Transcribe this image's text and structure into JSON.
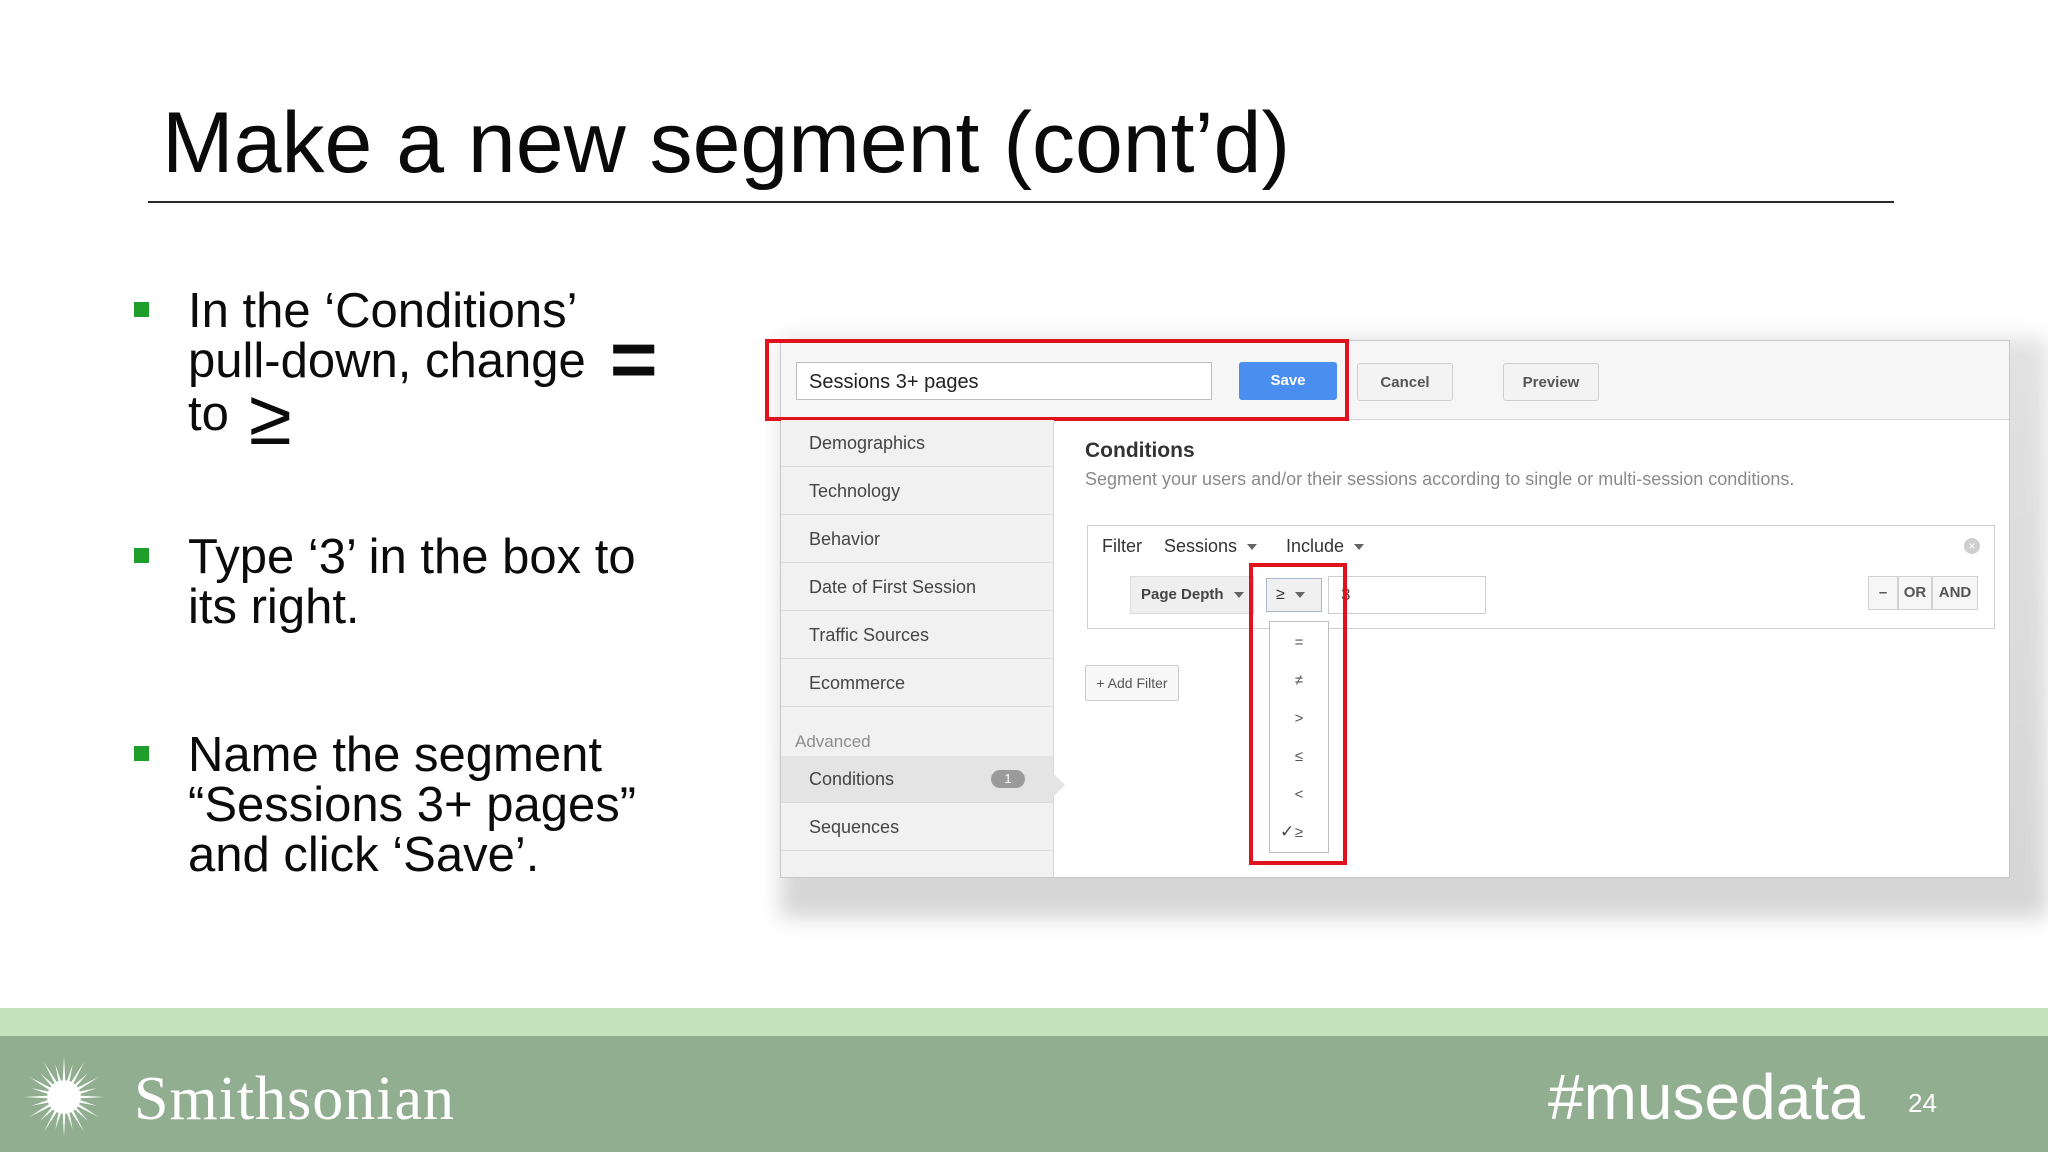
{
  "slide": {
    "title": "Make a new segment (cont’d)",
    "bullets": [
      {
        "lines": [
          "In the ‘Conditions’",
          "pull-down, change",
          "to"
        ],
        "symbol_equals": "=",
        "symbol_gte": "≥"
      },
      {
        "lines": [
          "Type ‘3’ in the box to",
          "its right."
        ]
      },
      {
        "lines": [
          "Name the segment",
          "“Sessions 3+ pages”",
          "and click ‘Save’."
        ]
      }
    ],
    "accent_color": "#1e9e2a",
    "highlight_color": "#e0121d"
  },
  "screenshot": {
    "segment_name": "Sessions 3+ pages",
    "buttons": {
      "save": "Save",
      "cancel": "Cancel",
      "preview": "Preview"
    },
    "nav": {
      "items": [
        "Demographics",
        "Technology",
        "Behavior",
        "Date of First Session",
        "Traffic Sources",
        "Ecommerce"
      ],
      "advanced_caption": "Advanced",
      "conditions": "Conditions",
      "conditions_badge": "1",
      "sequences": "Sequences"
    },
    "conditions": {
      "title": "Conditions",
      "description": "Segment your users and/or their sessions according to single or multi-session conditions."
    },
    "filter": {
      "label": "Filter",
      "scope": "Sessions",
      "mode": "Include",
      "dimension": "Page Depth",
      "operator": "≥",
      "value": "3",
      "logic_minus": "–",
      "logic_or": "OR",
      "logic_and": "AND",
      "add_filter": "+ Add Filter"
    },
    "operator_options": [
      "=",
      "≠",
      ">",
      "≤",
      "<",
      "≥"
    ],
    "operator_selected": "≥",
    "check_glyph": "✓"
  },
  "footer": {
    "org": "Smithsonian",
    "hashtag": "#musedata",
    "page": "24",
    "band_color": "#92ae90",
    "light_color": "#c3e3bd"
  }
}
